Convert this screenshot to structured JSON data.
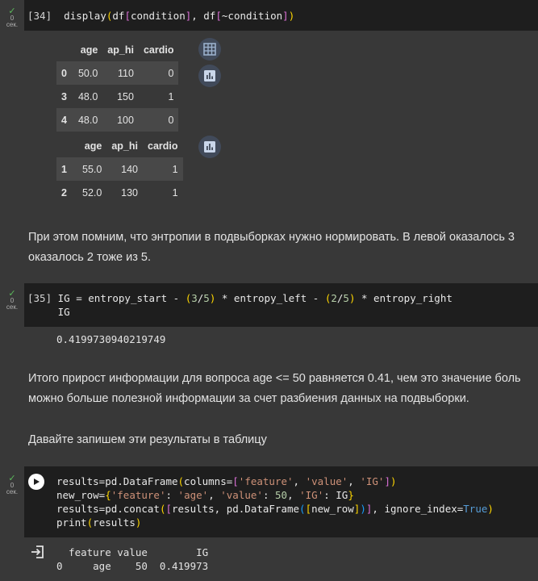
{
  "cells": {
    "c34": {
      "status": "✓",
      "count": "0",
      "unit": "сек.",
      "exec_count": "[34]",
      "code": "display(df[condition], df[~condition])"
    },
    "c35": {
      "status": "✓",
      "count": "0",
      "unit": "сек.",
      "exec_count": "[35]",
      "line1": "IG = entropy_start - (3/5) * entropy_left - (2/5) * entropy_right",
      "line2": "IG",
      "output": "0.4199730940219749"
    },
    "c36": {
      "status": "✓",
      "count": "0",
      "unit": "сек.",
      "line1": "results=pd.DataFrame(columns=['feature', 'value', 'IG'])",
      "line2": "new_row={'feature': 'age', 'value': 50, 'IG': IG}",
      "line3": "results=pd.concat([results, pd.DataFrame([new_row])], ignore_index=True)",
      "line4": "print(results)",
      "output_header": "  feature value        IG",
      "output_row": "0     age    50  0.419973"
    }
  },
  "df1": {
    "columns": [
      "age",
      "ap_hi",
      "cardio"
    ],
    "rows": [
      {
        "index": "0",
        "age": "50.0",
        "ap_hi": "110",
        "cardio": "0"
      },
      {
        "index": "3",
        "age": "48.0",
        "ap_hi": "150",
        "cardio": "1"
      },
      {
        "index": "4",
        "age": "48.0",
        "ap_hi": "100",
        "cardio": "0"
      }
    ]
  },
  "df2": {
    "columns": [
      "age",
      "ap_hi",
      "cardio"
    ],
    "rows": [
      {
        "index": "1",
        "age": "55.0",
        "ap_hi": "140",
        "cardio": "1"
      },
      {
        "index": "2",
        "age": "52.0",
        "ap_hi": "130",
        "cardio": "1"
      }
    ]
  },
  "text": {
    "p1_line1": "При этом помним, что энтропии в подвыборках нужно нормировать. В левой оказалось 3",
    "p1_line2": "оказалось 2 тоже из 5.",
    "p2_line1": "Итого прирост информации для вопроса age <= 50 равняется 0.41, чем это значение боль",
    "p2_line2": "можно больше полезной информации за счет разбиения данных на подвыборки.",
    "p3": "Давайте запишем эти результаты в таблицу"
  },
  "icons": {
    "table": "table-icon",
    "chart": "bar-chart-icon",
    "run": "play-icon",
    "output": "output-redirect-icon"
  },
  "colors": {
    "background": "#383838",
    "code_background": "#1e1e1e",
    "success": "#5cbb5c",
    "icon_button": "#414a5a"
  }
}
